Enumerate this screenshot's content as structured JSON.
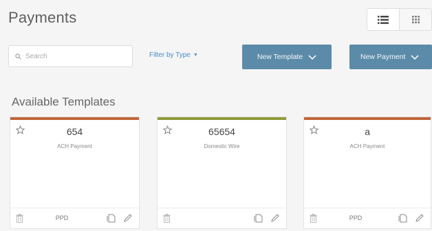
{
  "page": {
    "title": "Payments"
  },
  "view_toggle": {
    "list_icon": "list-icon",
    "grid_icon": "grid-icon",
    "active": "list"
  },
  "search": {
    "placeholder": "Search",
    "value": ""
  },
  "filter": {
    "label": "Filter by Type"
  },
  "buttons": {
    "new_template": "New Template",
    "new_payment": "New Payment"
  },
  "section": {
    "title": "Available Templates"
  },
  "templates": [
    {
      "name": "654",
      "type": "ACH Payment",
      "code": "PPD",
      "accent": "#c0663a"
    },
    {
      "name": "65654",
      "type": "Domestic Wire",
      "code": "",
      "accent": "#8f9a3a"
    },
    {
      "name": "a",
      "type": "ACH Payment",
      "code": "PPD",
      "accent": "#c0663a"
    }
  ],
  "colors": {
    "button": "#5b8ba8",
    "link": "#4a8bc4",
    "ach_accent": "#c0663a",
    "wire_accent": "#8f9a3a"
  }
}
